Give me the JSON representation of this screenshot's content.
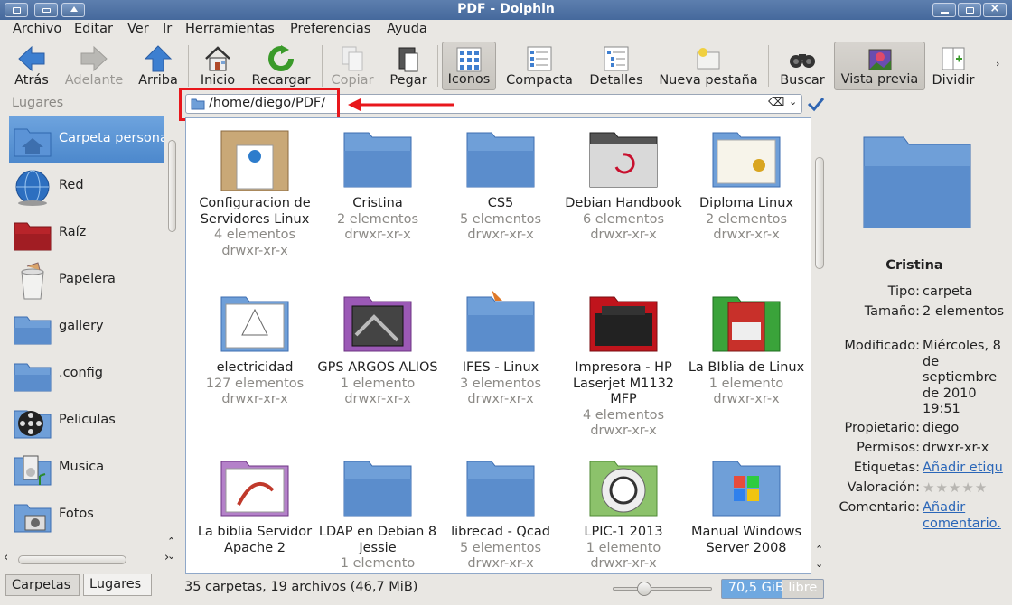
{
  "window": {
    "title": "PDF - Dolphin"
  },
  "menu": [
    "Archivo",
    "Editar",
    "Ver",
    "Ir",
    "Herramientas",
    "Preferencias",
    "Ayuda"
  ],
  "toolbar": {
    "back": "Atrás",
    "forward": "Adelante",
    "up": "Arriba",
    "home": "Inicio",
    "reload": "Recargar",
    "copy": "Copiar",
    "paste": "Pegar",
    "icons": "Iconos",
    "compact": "Compacta",
    "details": "Detalles",
    "new_tab": "Nueva pestaña",
    "search": "Buscar",
    "preview": "Vista previa",
    "split": "Dividir"
  },
  "places": {
    "title": "Lugares",
    "items": [
      "Carpeta personal",
      "Red",
      "Raíz",
      "Papelera",
      "gallery",
      ".config",
      "Peliculas",
      "Musica",
      "Fotos"
    ]
  },
  "bottom_tabs": [
    "Carpetas",
    "Lugares"
  ],
  "address": {
    "path": "/home/diego/PDF/"
  },
  "files": [
    {
      "name": "Configuracion de Servidores Linux",
      "count": "4 elementos",
      "perm": "drwxr-xr-x"
    },
    {
      "name": "Cristina",
      "count": "2 elementos",
      "perm": "drwxr-xr-x"
    },
    {
      "name": "CS5",
      "count": "5 elementos",
      "perm": "drwxr-xr-x"
    },
    {
      "name": "Debian Handbook",
      "count": "6 elementos",
      "perm": "drwxr-xr-x"
    },
    {
      "name": "Diploma Linux",
      "count": "2 elementos",
      "perm": "drwxr-xr-x"
    },
    {
      "name": "electricidad",
      "count": "127 elementos",
      "perm": "drwxr-xr-x"
    },
    {
      "name": "GPS ARGOS ALIOS",
      "count": "1 elemento",
      "perm": "drwxr-xr-x"
    },
    {
      "name": "IFES - Linux",
      "count": "3 elementos",
      "perm": "drwxr-xr-x"
    },
    {
      "name": "Impresora - HP Laserjet M1132 MFP",
      "count": "4 elementos",
      "perm": "drwxr-xr-x"
    },
    {
      "name": "La BIblia de Linux",
      "count": "1 elemento",
      "perm": "drwxr-xr-x"
    },
    {
      "name": "La biblia Servidor Apache 2",
      "count": "",
      "perm": ""
    },
    {
      "name": "LDAP en Debian 8 Jessie",
      "count": "1 elemento",
      "perm": ""
    },
    {
      "name": "librecad - Qcad",
      "count": "5 elementos",
      "perm": "drwxr-xr-x"
    },
    {
      "name": "LPIC-1 2013",
      "count": "1 elemento",
      "perm": "drwxr-xr-x"
    },
    {
      "name": "Manual Windows Server 2008",
      "count": "",
      "perm": ""
    }
  ],
  "info": {
    "name": "Cristina",
    "tipo_k": "Tipo:",
    "tipo_v": "carpeta",
    "tam_k": "Tamaño:",
    "tam_v": "2 elementos",
    "mod_k": "Modificado:",
    "mod_v": "Miércoles, 8 de septiembre de 2010 19:51",
    "prop_k": "Propietario:",
    "prop_v": "diego",
    "perm_k": "Permisos:",
    "perm_v": "drwxr-xr-x",
    "tag_k": "Etiquetas:",
    "tag_v": "Añadir etiqu",
    "rate_k": "Valoración:",
    "rating": 0,
    "com_k": "Comentario:",
    "com_v": "Añadir comentario."
  },
  "status": {
    "summary": "35 carpetas, 19 archivos (46,7 MiB)",
    "free": "70,5 GiB libre",
    "free_fraction": 0.6
  },
  "colors": {
    "selection": "#4c88cc",
    "highlight_box": "#e8171c",
    "folder": "#6f9fd8"
  }
}
